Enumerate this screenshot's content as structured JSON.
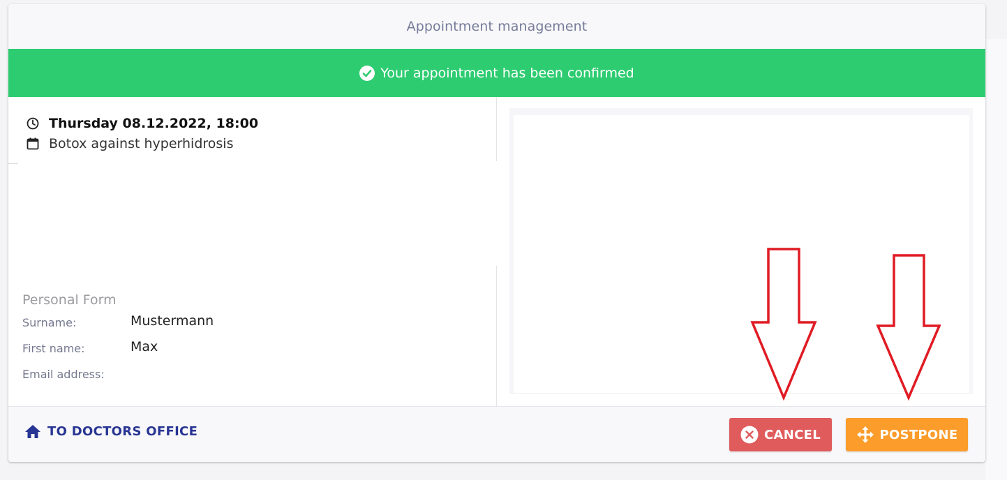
{
  "header": {
    "title": "Appointment management"
  },
  "banner": {
    "text": "Your appointment has been confirmed",
    "color": "#2ecc71"
  },
  "appointment": {
    "datetime": "Thursday 08.12.2022, 18:00",
    "service": "Botox against hyperhidrosis"
  },
  "personal_form": {
    "title": "Personal Form",
    "fields": [
      {
        "label": "Surname:",
        "value": "Mustermann"
      },
      {
        "label": "First name:",
        "value": "Max"
      },
      {
        "label": "Email address:",
        "value": ""
      }
    ]
  },
  "footer": {
    "home_label": "TO DOCTORS OFFICE",
    "cancel_label": "CANCEL",
    "postpone_label": "POSTPONE"
  },
  "colors": {
    "primary": "#283593",
    "cancel": "#e05b5b",
    "postpone": "#fb9c2b",
    "annotation_arrow": "#e01b24"
  },
  "icons": {
    "banner": "check-circle-icon",
    "datetime": "clock-icon",
    "service": "calendar-icon",
    "home": "home-icon",
    "cancel": "close-circle-icon",
    "postpone": "move-arrows-icon"
  }
}
